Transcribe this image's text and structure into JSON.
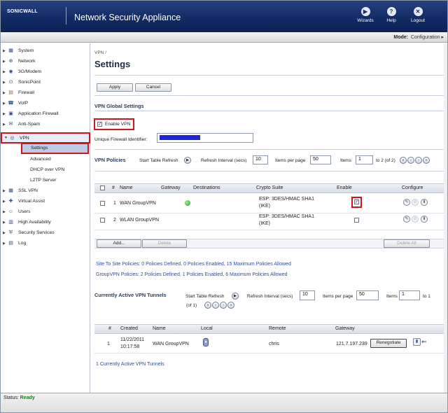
{
  "header": {
    "logo": "SONICWALL",
    "title": "Network Security Appliance",
    "buttons": [
      {
        "label": "Wizards",
        "icon": "wizard-icon"
      },
      {
        "label": "Help",
        "icon": "help-icon"
      },
      {
        "label": "Logout",
        "icon": "logout-icon"
      }
    ]
  },
  "modebar": {
    "label": "Mode:",
    "value": "Configuration ▸"
  },
  "sidebar": {
    "items": [
      {
        "label": "System"
      },
      {
        "label": "Network"
      },
      {
        "label": "3G/Modem"
      },
      {
        "label": "SonicPoint"
      },
      {
        "label": "Firewall"
      },
      {
        "label": "VoIP"
      },
      {
        "label": "Application Firewall"
      },
      {
        "label": "Anti-Spam"
      },
      {
        "label": "VPN"
      }
    ],
    "vpn_sub": [
      "Settings",
      "Advanced",
      "DHCP over VPN",
      "L2TP Server"
    ],
    "items2": [
      {
        "label": "SSL VPN"
      },
      {
        "label": "Virtual Assist"
      },
      {
        "label": "Users"
      },
      {
        "label": "High Availability"
      },
      {
        "label": "Security Services"
      },
      {
        "label": "Log"
      }
    ]
  },
  "page": {
    "breadcrumb": "VPN /",
    "title": "Settings"
  },
  "buttons": {
    "apply": "Apply",
    "cancel": "Cancel"
  },
  "global": {
    "heading": "VPN Global Settings",
    "enable_vpn": "Enable VPN",
    "uid_label": "Unique Firewall Identifier:"
  },
  "policies": {
    "heading": "VPN Policies",
    "start_refresh": "Start Table Refresh",
    "refresh_interval_label": "Refresh Interval (secs)",
    "refresh_interval": "10",
    "items_per_page_label": "Items per page",
    "items_per_page": "50",
    "items_label": "Items",
    "items_from": "1",
    "items_range": "to 2 (of 2)",
    "columns": [
      "#",
      "Name",
      "Gateway",
      "Destinations",
      "Crypto Suite",
      "Enable",
      "Configure"
    ],
    "rows": [
      {
        "num": "1",
        "name": "WAN GroupVPN",
        "crypto1": "ESP: 3DES/HMAC SHA1",
        "crypto2": "(IKE)"
      },
      {
        "num": "2",
        "name": "WLAN GroupVPN",
        "crypto1": "ESP: 3DES/HMAC SHA1",
        "crypto2": "(IKE)"
      }
    ],
    "add": "Add...",
    "delete": "Delete",
    "delete_all": "Delete All",
    "summary1": "Site To Site Policies: 0 Policies Defined, 0 Policies Enabled, 15 Maximum Policies Allowed",
    "summary2": "GroupVPN Policies: 2 Policies Defined, 1 Policies Enabled, 6 Maximum Policies Allowed"
  },
  "tunnels": {
    "heading": "Currently Active VPN Tunnels",
    "start_refresh": "Start Table Refresh",
    "page_of": "(of 1)",
    "refresh_interval_label": "Refresh Interval (secs)",
    "refresh_interval": "10",
    "items_per_page_label": "Items per page",
    "items_per_page": "50",
    "items_label": "Items",
    "items_from": "1",
    "items_to": "to 1",
    "columns": [
      "#",
      "Created",
      "Name",
      "Local",
      "Remote",
      "Gateway"
    ],
    "row": {
      "num": "1",
      "created1": "11/22/2011",
      "created2": "10:17:58",
      "name": "WAN GroupVPN",
      "remote": "chris",
      "gateway": "121.7.197.239",
      "button": "Renegotiate"
    },
    "footer": "1 Currently Active VPN Tunnels"
  },
  "status": {
    "label": "Status:",
    "value": "Ready"
  },
  "colors": {
    "header": "#112a63",
    "highlight": "#d1131c",
    "link": "#2a4ca3"
  }
}
